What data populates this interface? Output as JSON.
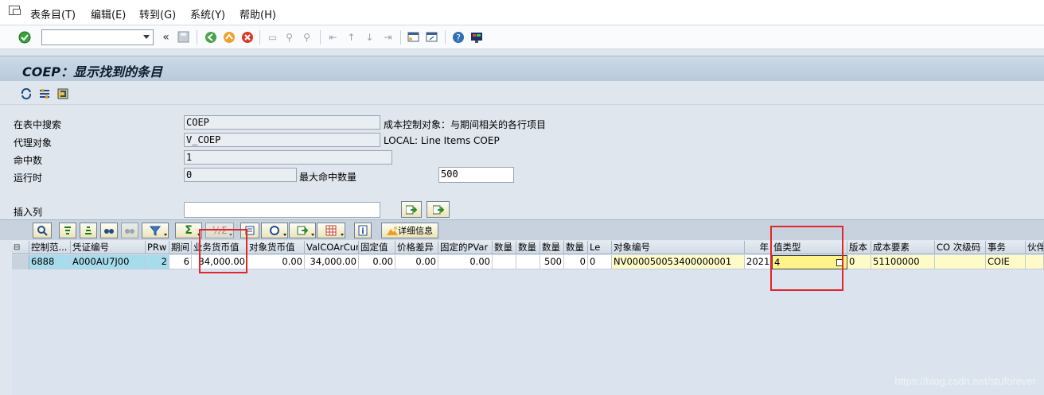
{
  "menubar": {
    "items": [
      "表条目(T)",
      "编辑(E)",
      "转到(G)",
      "系统(Y)",
      "帮助(H)"
    ]
  },
  "toolbar": {
    "command_value": ""
  },
  "title": "COEP：显示找到的条目",
  "form": {
    "search_table_label": "在表中搜索",
    "search_table_value": "COEP",
    "search_table_desc": "成本控制对象：与期间相关的各行项目",
    "proxy_label": "代理对象",
    "proxy_value": "V_COEP",
    "proxy_desc": "LOCAL: Line Items COEP",
    "hits_label": "命中数",
    "hits_value": "1",
    "runtime_label": "运行时",
    "runtime_value": "0",
    "max_hits_label": "最大命中数量",
    "max_hits_value": "500",
    "insert_col_label": "插入列",
    "insert_col_value": ""
  },
  "alv": {
    "details_label": "详细信息"
  },
  "grid": {
    "headers": [
      "控制范...",
      "凭证编号",
      "PRw",
      "期间",
      "业务货币值",
      "对象货币值",
      "ValCOArCur",
      "固定值",
      "价格差异",
      "固定的PVar",
      "数量",
      "数量",
      "数量",
      "数量",
      "Le",
      "对象编号",
      "年",
      "值类型",
      "版本",
      "成本要素",
      "CO 次级码",
      "事务",
      "伙伴"
    ],
    "row": [
      "6888",
      "A000AU7J00",
      "2",
      "6",
      "34,000.00",
      "0.00",
      "34,000.00",
      "0.00",
      "0.00",
      "0.00",
      "",
      "",
      "500",
      "0",
      "0",
      "NV000050053400000001",
      "2021",
      "4",
      "0",
      "51100000",
      "",
      "COIE",
      ""
    ]
  },
  "watermark": "https://blog.csdn.net/stuforever",
  "colors": {
    "key_cell": "#a7dced",
    "highlight_box": "#e0252b",
    "title_bar": "#c3d2e2"
  }
}
